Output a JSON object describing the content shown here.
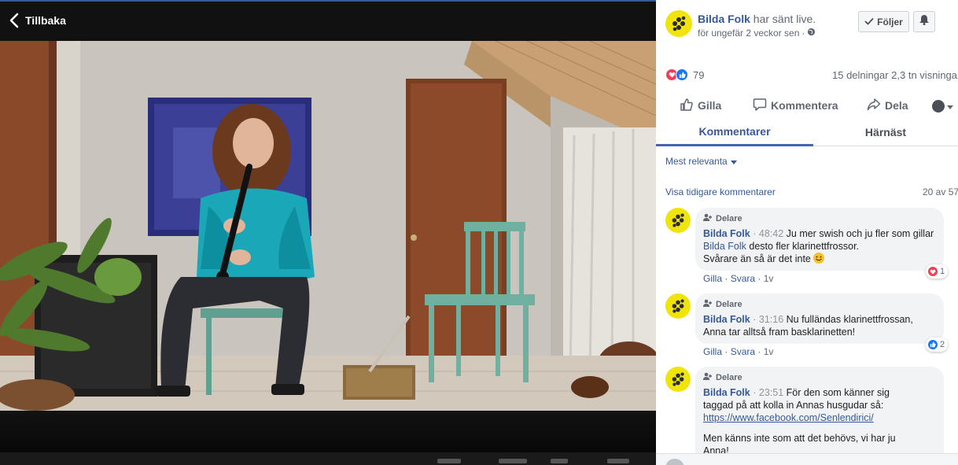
{
  "video": {
    "back_label": "Tillbaka"
  },
  "post": {
    "page_name": "Bilda Folk",
    "action_text": "har sänt live.",
    "time_text": "för ungefär 2 veckor sen",
    "follow_label": "Följer",
    "reaction_count": "79",
    "shares_views": "15 delningar  2,3 tn visningar"
  },
  "actions": {
    "like": "Gilla",
    "comment": "Kommentera",
    "share": "Dela"
  },
  "tabs": {
    "comments": "Kommentarer",
    "next": "Härnäst"
  },
  "comments_section": {
    "sort_label": "Mest relevanta",
    "prev_link": "Visa tidigare kommentarer",
    "counter": "20 av 57"
  },
  "comments": [
    {
      "badge": "Delare",
      "author": "Bilda Folk",
      "time": "48:42",
      "text_a": "Ju mer swish och ju fler som gillar",
      "mention": "Bilda Folk",
      "text_b": "desto fler klarinettfrossor.",
      "text_c": "Svårare än så är det inte",
      "like": "Gilla",
      "reply": "Svara",
      "age": "1v",
      "reaction_count": "1"
    },
    {
      "badge": "Delare",
      "author": "Bilda Folk",
      "time": "31:16",
      "text_a": "Nu fulländas klarinettfrossan,",
      "text_b": "Anna tar alltså fram basklarinetten!",
      "like": "Gilla",
      "reply": "Svara",
      "age": "1v",
      "reaction_count": "2"
    },
    {
      "badge": "Delare",
      "author": "Bilda Folk",
      "time": "23:51",
      "text_a": "För den som känner sig",
      "text_b": "taggad på att kolla in Annas husgudar så:",
      "link": "https://www.facebook.com/Senlendirici/",
      "text_c": "Men känns inte som att det behövs, vi har ju",
      "text_d": "Anna!"
    }
  ],
  "colors": {
    "brand_blue": "#365899",
    "avatar_yellow": "#f1e40b",
    "love_red": "#f33e58",
    "like_blue": "#1877f2"
  },
  "icons": [
    "chevron-left-icon",
    "globe-icon",
    "checkmark-icon",
    "bell-icon",
    "like-icon",
    "comment-icon",
    "share-icon",
    "caret-down-icon",
    "page-role-icon"
  ]
}
